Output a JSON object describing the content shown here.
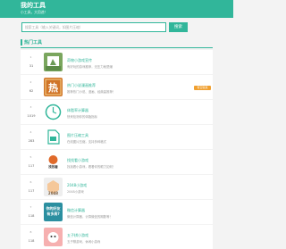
{
  "brand": {
    "title": "我的工具",
    "subtitle": "小工具，大用途！"
  },
  "search": {
    "placeholder": "搜索工具（输入关键词，如图片压缩）",
    "button": "搜索"
  },
  "section": {
    "title": "热门工具"
  },
  "items": [
    {
      "dot": "1",
      "count": "31",
      "name": "奇物小游戏宣传",
      "desc": "有好玩的游戏推荐，无压力就是赚",
      "thumb_bg": "#6d9b58",
      "thumb_text": ""
    },
    {
      "dot": "2",
      "count": "62",
      "name": "热门小说漫画推荐",
      "desc": "推荐热门小说、漫画、经典量推荐！",
      "thumb_bg": "#c76b20",
      "thumb_text": "热",
      "badge": "有空就来"
    },
    {
      "dot": "3",
      "count": "1019",
      "name": "体脂率计算器",
      "desc": "快来检测你的体脂指标",
      "thumb_bg": "#ffffff",
      "thumb_text": ""
    },
    {
      "dot": "4",
      "count": "283",
      "name": "图片压缩工具",
      "desc": "在线图片压缩，支持多种格式",
      "thumb_bg": "#ffffff",
      "thumb_text": ""
    },
    {
      "dot": "5",
      "count": "117",
      "name": "找找看小游戏",
      "desc": "找找看小游戏，看看你的眼力如何！",
      "thumb_bg": "#ffffff",
      "thumb_text": "找找看"
    },
    {
      "dot": "6",
      "count": "117",
      "name": "2048小游戏",
      "desc": "2048小游戏",
      "thumb_bg": "#eeeeee",
      "thumb_text": "2048"
    },
    {
      "dot": "7",
      "count": "118",
      "name": "微信计算器",
      "desc": "微信计算器，计算微信的期数等！",
      "thumb_bg": "#2b8fa0",
      "thumb_text": "你的好友 有多高?"
    },
    {
      "dot": "8",
      "count": "118",
      "name": "五子棋小游戏",
      "desc": "五子棋游戏，休闲小游戏",
      "thumb_bg": "#f6b0b0",
      "thumb_text": ""
    }
  ],
  "colors": {
    "accent": "#31b69a",
    "badge": "#f0a030"
  }
}
